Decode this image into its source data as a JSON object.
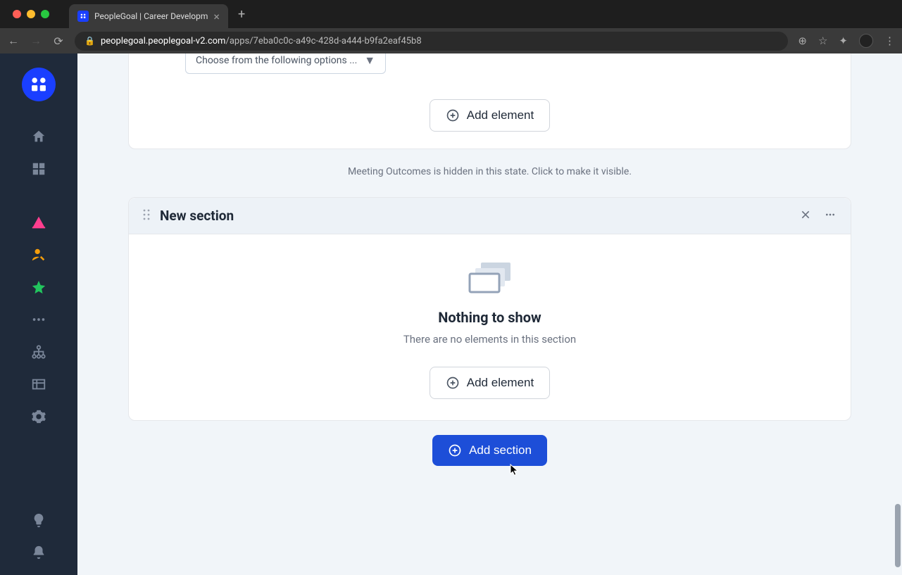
{
  "browser": {
    "tab_title": "PeopleGoal | Career Developm",
    "url_domain": "peoplegoal.peoplegoal-v2.com",
    "url_path": "/apps/7eba0c0c-a49c-428d-a444-b9fa2eaf45b8"
  },
  "top_card": {
    "dropdown_label": "Choose from the following options ...",
    "add_element_label": "Add element"
  },
  "hidden_notice": "Meeting Outcomes is hidden in this state. Click to make it visible.",
  "new_section": {
    "title": "New section",
    "empty_title": "Nothing to show",
    "empty_subtitle": "There are no elements in this section",
    "add_element_label": "Add element"
  },
  "add_section_label": "Add section"
}
